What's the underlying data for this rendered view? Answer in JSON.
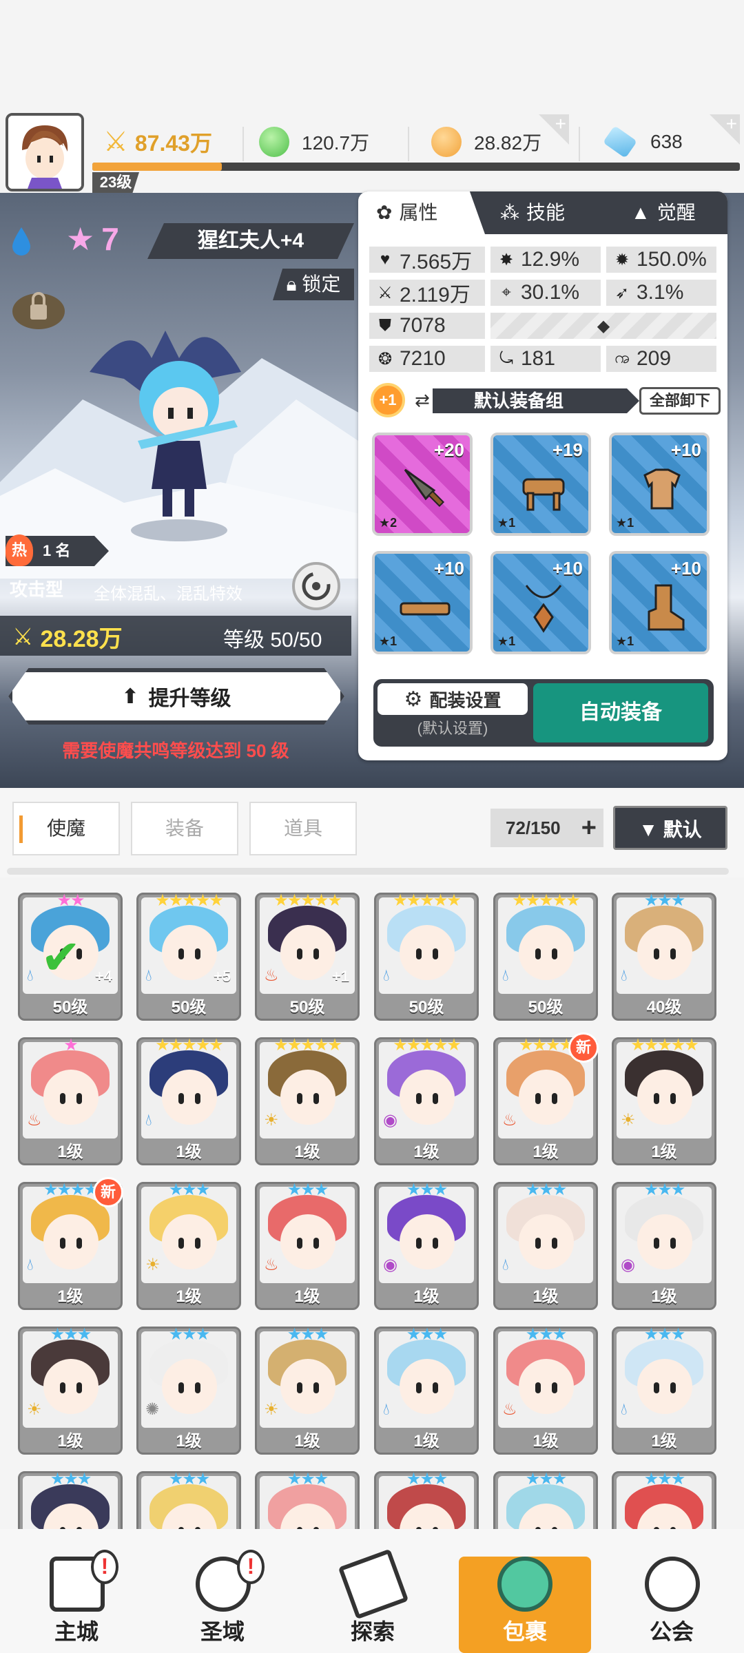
{
  "topbar": {
    "player_level": "23级",
    "power": "87.43万",
    "green_currency": "120.7万",
    "gold_currency": "28.82万",
    "gems": "638",
    "exp_progress": 0.2
  },
  "hero": {
    "name": "猩红夫人+4",
    "star_level": "7",
    "lock_label": "锁定",
    "hot_rank": "1 名",
    "hot_label": "热",
    "type": "攻击型",
    "skill_desc": "全体混乱、混乱特效",
    "power": "28.28万",
    "level": "等级 50/50",
    "upgrade_label": "提升等级",
    "requirement": "需要使魔共鸣等级达到 50 级"
  },
  "panel": {
    "tabs": [
      "属性",
      "技能",
      "觉醒"
    ],
    "stats": {
      "hp": "7.565万",
      "crit_rate": "12.9%",
      "crit_dmg": "150.0%",
      "attack": "2.119万",
      "accuracy": "30.1%",
      "speed": "3.1%",
      "defense": "7078",
      "stat_a": "7210",
      "stat_b": "181",
      "stat_c": "209"
    },
    "equip_badge": "+1",
    "equip_group": "默认装备组",
    "unload_all": "全部卸下",
    "equipment": [
      {
        "plus": "+20",
        "stars": "★2",
        "item": "sword",
        "rarity": "pink"
      },
      {
        "plus": "+19",
        "stars": "★1",
        "item": "helmet",
        "rarity": "blue"
      },
      {
        "plus": "+10",
        "stars": "★1",
        "item": "armor",
        "rarity": "blue"
      },
      {
        "plus": "+10",
        "stars": "★1",
        "item": "belt",
        "rarity": "blue"
      },
      {
        "plus": "+10",
        "stars": "★1",
        "item": "necklace",
        "rarity": "blue"
      },
      {
        "plus": "+10",
        "stars": "★1",
        "item": "boots",
        "rarity": "blue"
      }
    ],
    "config_label": "配装设置",
    "config_sub": "(默认设置)",
    "auto_equip": "自动装备"
  },
  "inventory": {
    "tabs": [
      "使魔",
      "装备",
      "道具"
    ],
    "count": "72/150",
    "sort_label": "▼ 默认",
    "heroes": [
      {
        "level": "50级",
        "stars": "★★",
        "star_color": "#ff6fd8",
        "element": "water",
        "plus": "+4",
        "checked": true,
        "color": "#4aa3d9"
      },
      {
        "level": "50级",
        "stars": "★★★★★",
        "star_color": "#ffd23a",
        "element": "water",
        "plus": "+5",
        "color": "#6fc7ef"
      },
      {
        "level": "50级",
        "stars": "★★★★★",
        "star_color": "#ffd23a",
        "element": "fire",
        "plus": "+1",
        "color": "#3a2f4f"
      },
      {
        "level": "50级",
        "stars": "★★★★★",
        "star_color": "#ffd23a",
        "element": "water",
        "color": "#b9dff5"
      },
      {
        "level": "50级",
        "stars": "★★★★★",
        "star_color": "#ffd23a",
        "element": "water",
        "color": "#88c9ea"
      },
      {
        "level": "40级",
        "stars": "★★★",
        "star_color": "#49b8f0",
        "element": "water",
        "color": "#d9b07a"
      },
      {
        "level": "1级",
        "stars": "★",
        "star_color": "#ff6fd8",
        "element": "fire",
        "color": "#f08a8a"
      },
      {
        "level": "1级",
        "stars": "★★★★★",
        "star_color": "#ffd23a",
        "element": "water",
        "color": "#2c3d7a"
      },
      {
        "level": "1级",
        "stars": "★★★★★",
        "star_color": "#ffd23a",
        "element": "light",
        "color": "#8a6a3a"
      },
      {
        "level": "1级",
        "stars": "★★★★★",
        "star_color": "#ffd23a",
        "element": "dark",
        "color": "#9b6ad8"
      },
      {
        "level": "1级",
        "stars": "★★★★",
        "star_color": "#ffd23a",
        "element": "fire",
        "new": "新",
        "color": "#e8a06a"
      },
      {
        "level": "1级",
        "stars": "★★★★★",
        "star_color": "#ffd23a",
        "element": "light",
        "color": "#3a3030"
      },
      {
        "level": "1级",
        "stars": "★★★★",
        "star_color": "#49b8f0",
        "element": "water",
        "new": "新",
        "color": "#f0b84a"
      },
      {
        "level": "1级",
        "stars": "★★★",
        "star_color": "#49b8f0",
        "element": "light",
        "color": "#f5d06a"
      },
      {
        "level": "1级",
        "stars": "★★★",
        "star_color": "#49b8f0",
        "element": "fire",
        "color": "#e86a6a"
      },
      {
        "level": "1级",
        "stars": "★★★",
        "star_color": "#49b8f0",
        "element": "dark",
        "color": "#7a4ac8"
      },
      {
        "level": "1级",
        "stars": "★★★",
        "star_color": "#49b8f0",
        "element": "water",
        "color": "#f0e0d8"
      },
      {
        "level": "1级",
        "stars": "★★★",
        "star_color": "#49b8f0",
        "element": "dark",
        "color": "#e8e8e8"
      },
      {
        "level": "1级",
        "stars": "★★★",
        "star_color": "#49b8f0",
        "element": "light",
        "color": "#4a3a3a"
      },
      {
        "level": "1级",
        "stars": "★★★",
        "star_color": "#49b8f0",
        "element": "wind",
        "color": "#eeeeee"
      },
      {
        "level": "1级",
        "stars": "★★★",
        "star_color": "#49b8f0",
        "element": "light",
        "color": "#d4b070"
      },
      {
        "level": "1级",
        "stars": "★★★",
        "star_color": "#49b8f0",
        "element": "water",
        "color": "#a8d8f0"
      },
      {
        "level": "1级",
        "stars": "★★★",
        "star_color": "#49b8f0",
        "element": "fire",
        "color": "#f08a8a"
      },
      {
        "level": "1级",
        "stars": "★★★",
        "star_color": "#49b8f0",
        "element": "water",
        "color": "#cfe6f5"
      },
      {
        "level": "",
        "stars": "★★★",
        "star_color": "#49b8f0",
        "element": "",
        "color": "#3a3a5a"
      },
      {
        "level": "",
        "stars": "★★★",
        "star_color": "#49b8f0",
        "element": "",
        "color": "#f0d070"
      },
      {
        "level": "",
        "stars": "★★★",
        "star_color": "#49b8f0",
        "element": "",
        "color": "#f0a0a0"
      },
      {
        "level": "",
        "stars": "★★★",
        "star_color": "#49b8f0",
        "element": "",
        "color": "#c04a4a"
      },
      {
        "level": "",
        "stars": "★★★",
        "star_color": "#49b8f0",
        "element": "",
        "color": "#a0d8e8"
      },
      {
        "level": "",
        "stars": "★★★",
        "star_color": "#49b8f0",
        "element": "",
        "color": "#e05050"
      }
    ]
  },
  "nav": {
    "items": [
      "主城",
      "圣域",
      "探索",
      "包裹",
      "公会"
    ],
    "alerts": [
      "!",
      "!"
    ]
  },
  "colors": {
    "accent_orange": "#f4a023",
    "auto_green": "#17957f",
    "dark_panel": "#3b3f47",
    "warning_red": "#ff4d4d"
  }
}
